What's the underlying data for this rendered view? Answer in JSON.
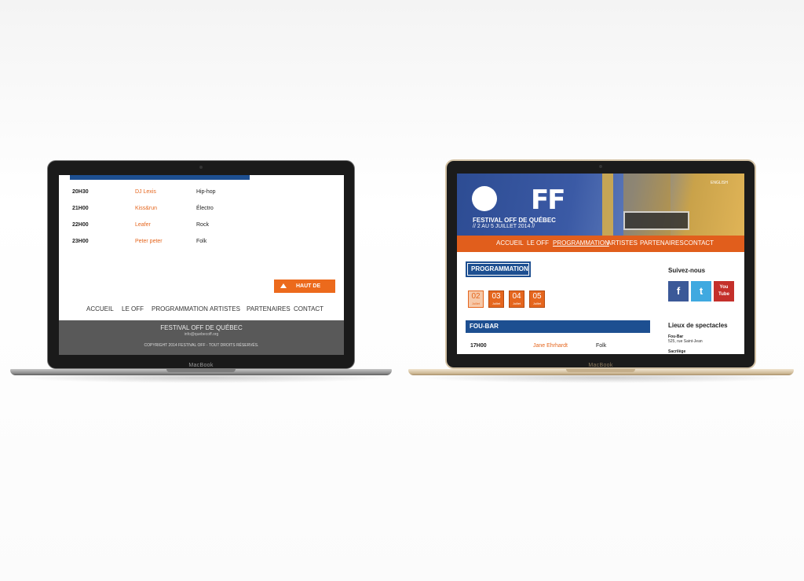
{
  "brand": "MacBook",
  "left_screen": {
    "schedule": [
      {
        "time": "20H30",
        "artist": "DJ Lexis",
        "genre": "Hip-hop"
      },
      {
        "time": "21H00",
        "artist": "Kiss&run",
        "genre": "Électro"
      },
      {
        "time": "22H00",
        "artist": "Leafer",
        "genre": "Rock"
      },
      {
        "time": "23H00",
        "artist": "Peter peter",
        "genre": "Folk"
      }
    ],
    "back_to_top": "HAUT DE PAGE",
    "nav": [
      "ACCUEIL",
      "LE OFF",
      "PROGRAMMATION",
      "ARTISTES",
      "PARTENAIRES",
      "CONTACT"
    ],
    "footer": {
      "title": "FESTIVAL OFF DE QUÉBEC",
      "email": "info@quebecoff.org",
      "copyright": "COPYRIGHT 2014 FESTIVAL OFF - TOUT DROITS RÉSERVÉS."
    }
  },
  "right_screen": {
    "language_link": "ENGLISH",
    "logo_text": "FF",
    "hero_title": "FESTIVAL OFF DE QUÉBEC",
    "hero_dates": "// 2 AU 5 JUILLET 2014 //",
    "nav": [
      "ACCUEIL",
      "LE OFF",
      "PROGRAMMATION",
      "ARTISTES",
      "PARTENAIRES",
      "CONTACT"
    ],
    "active_nav": "PROGRAMMATION",
    "section_title": "PROGRAMMATION",
    "days": [
      {
        "num": "02",
        "month": "Juillet",
        "selected": true
      },
      {
        "num": "03",
        "month": "Juillet",
        "selected": false
      },
      {
        "num": "04",
        "month": "Juillet",
        "selected": false
      },
      {
        "num": "05",
        "month": "Juillet",
        "selected": false
      }
    ],
    "venue_title": "FOU-BAR",
    "schedule": [
      {
        "time": "17H00",
        "artist": "Jane Ehrhardt",
        "genre": "Folk"
      }
    ],
    "sidebar": {
      "follow_title": "Suivez-nous",
      "social": [
        {
          "icon": "facebook-icon",
          "glyph": "f",
          "color": "#3b5998"
        },
        {
          "icon": "twitter-icon",
          "glyph": "t",
          "color": "#3fa9e0"
        },
        {
          "icon": "youtube-icon",
          "glyph": "You Tube",
          "color": "#c4302b"
        }
      ],
      "venues_title": "Lieux de spectacles",
      "venues": [
        {
          "name": "Fou-Bar",
          "address": "525, rue Saint-Jean"
        },
        {
          "name": "Sacrilège",
          "address": ""
        }
      ]
    }
  },
  "colors": {
    "blue": "#1d4f91",
    "orange": "#e5661e",
    "footer_grey": "#595959"
  }
}
